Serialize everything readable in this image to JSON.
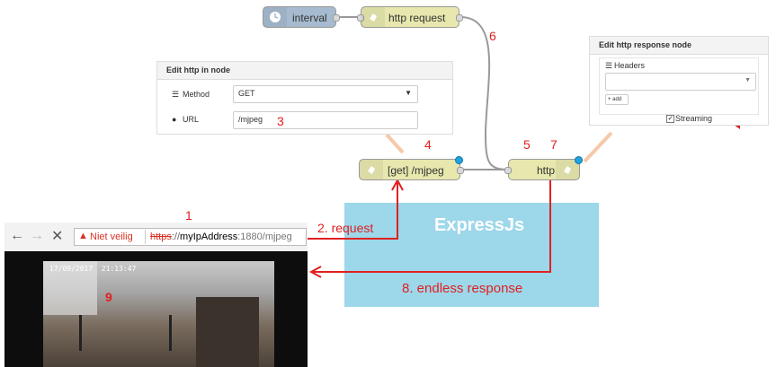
{
  "flow": {
    "interval_label": "interval",
    "http_request_label": "http request",
    "http_in_label": "[get] /mjpeg",
    "http_response_label": "http"
  },
  "http_in_editor": {
    "title": "Edit http in node",
    "method_label": "Method",
    "method_value": "GET",
    "url_label": "URL",
    "url_value": "/mjpeg"
  },
  "http_response_editor": {
    "title": "Edit http response node",
    "headers_label": "Headers",
    "add_label": "+ add",
    "streaming_label": "Streaming",
    "streaming_checked": true
  },
  "browser": {
    "security_text": "Niet veilig",
    "url_scheme": "https",
    "url_sep": "://",
    "url_host": "myIpAddress",
    "url_rest": ":1880/mjpeg",
    "video_timestamp": "17/09/2017  21:13:47"
  },
  "express": {
    "label": "ExpressJs"
  },
  "annotations": {
    "n1": "1",
    "request": "2. request",
    "n3": "3",
    "n4": "4",
    "n5": "5",
    "n6": "6",
    "n7": "7",
    "endless": "8. endless response",
    "n9": "9"
  },
  "colors": {
    "interval_node": "#a6bbcf",
    "http_node": "#e7e7ae",
    "annotation_red": "#e02020",
    "express_box": "#9dd7ea",
    "status_dot": "#1fa2e0"
  }
}
